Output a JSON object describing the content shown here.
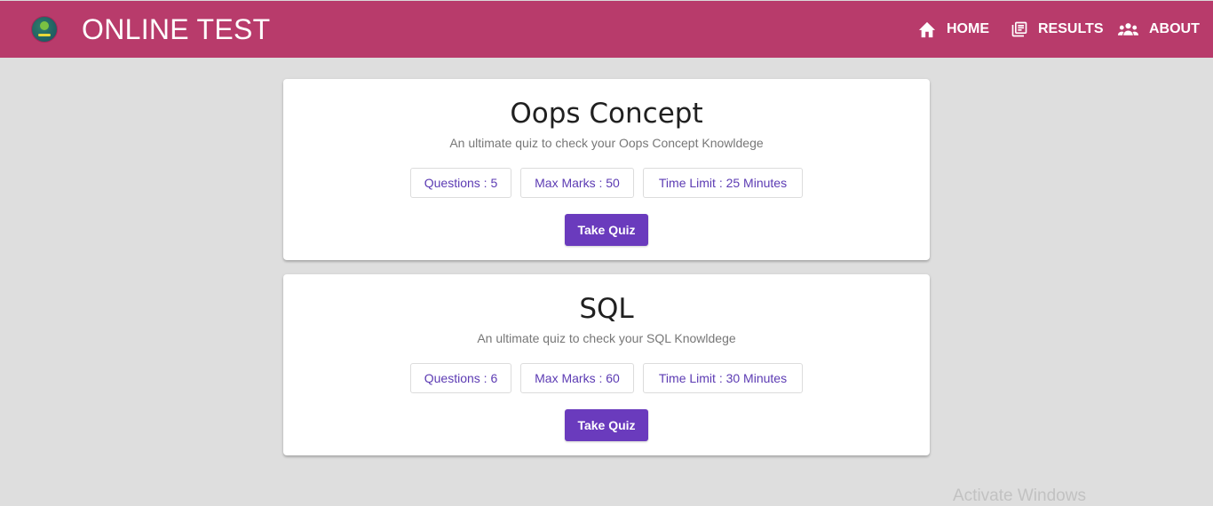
{
  "header": {
    "title": "ONLINE TEST",
    "background": "#b83b6b",
    "nav": [
      {
        "label": "HOME",
        "icon": "home-icon"
      },
      {
        "label": "RESULTS",
        "icon": "library-books-icon"
      },
      {
        "label": "ABOUT",
        "icon": "people-icon"
      }
    ]
  },
  "quizzes": [
    {
      "title": "Oops Concept",
      "description": "An ultimate quiz to check your Oops Concept Knowldege",
      "questions": "Questions : 5",
      "max_marks": "Max Marks : 50",
      "time_limit": "Time Limit : 25 Minutes",
      "button": "Take Quiz"
    },
    {
      "title": "SQL",
      "description": "An ultimate quiz to check your SQL Knowldege",
      "questions": "Questions : 6",
      "max_marks": "Max Marks : 60",
      "time_limit": "Time Limit : 30 Minutes",
      "button": "Take Quiz"
    }
  ],
  "watermark": "Activate Windows",
  "colors": {
    "accent": "#6a3bbd",
    "chip_text": "#5c3bb3",
    "page_background": "#dedede"
  }
}
